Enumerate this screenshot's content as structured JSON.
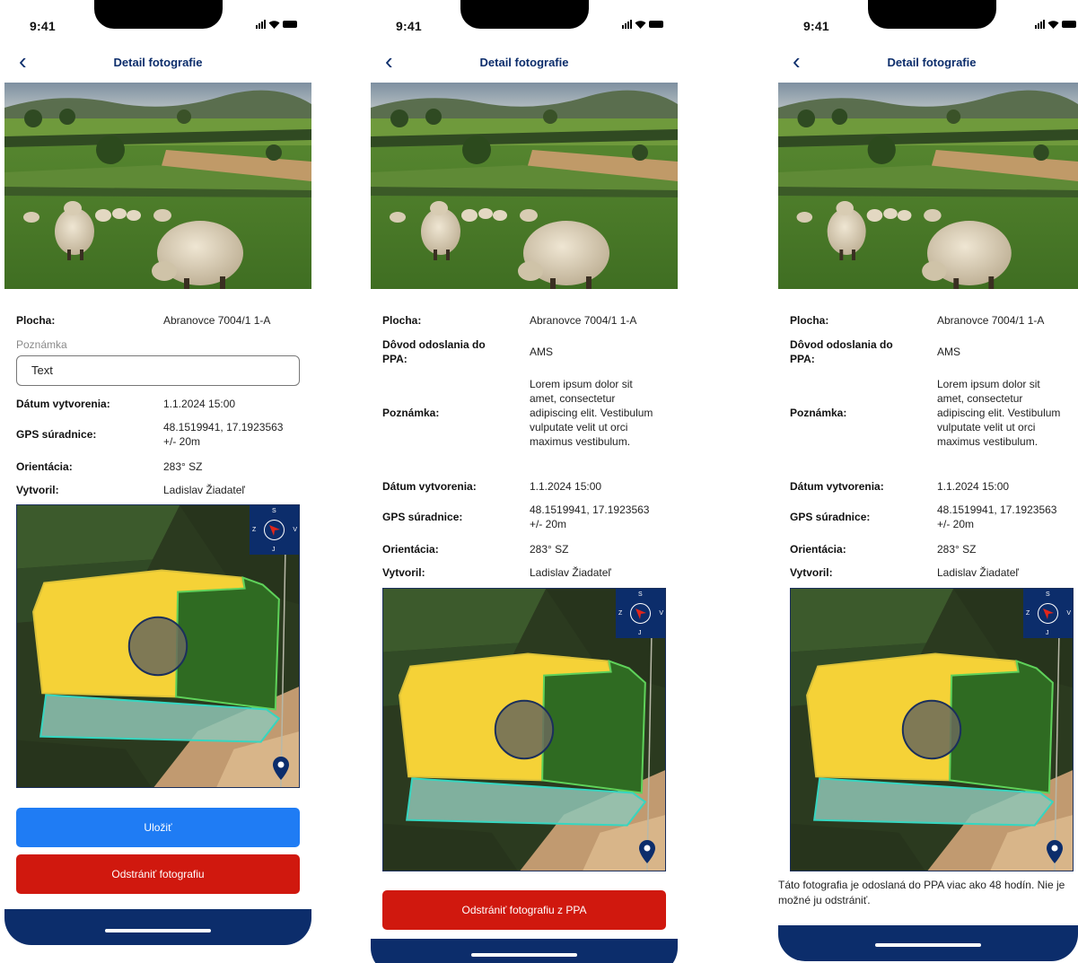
{
  "status": {
    "time": "9:41"
  },
  "screens": [
    {
      "title": "Detail fotografie",
      "fields": {
        "plocha_label": "Plocha:",
        "plocha_value": "Abranovce 7004/1 1-A",
        "poznamka_label": "Poznámka",
        "poznamka_value": "Text",
        "datum_label": "Dátum vytvorenia:",
        "datum_value": "1.1.2024 15:00",
        "gps_label": "GPS súradnice:",
        "gps_value": "48.1519941, 17.1923563 +/- 20m",
        "orientacia_label": "Orientácia:",
        "orientacia_value": "283° SZ",
        "vytvoril_label": "Vytvoril:",
        "vytvoril_value": "Ladislav Žiadateľ"
      },
      "compass": {
        "n": "S",
        "e": "V",
        "s": "J",
        "w": "Z"
      },
      "buttons": {
        "save": "Uložiť",
        "delete": "Odstrániť fotografiu"
      }
    },
    {
      "title": "Detail fotografie",
      "fields": {
        "plocha_label": "Plocha:",
        "plocha_value": "Abranovce 7004/1 1-A",
        "dovod_label": "Dôvod odoslania do PPA:",
        "dovod_value": "AMS",
        "poznamka_label": "Poznámka:",
        "poznamka_value": "Lorem ipsum dolor sit amet, consectetur adipiscing elit. Vestibulum vulputate velit ut orci maximus vestibulum.",
        "datum_label": "Dátum vytvorenia:",
        "datum_value": "1.1.2024 15:00",
        "gps_label": "GPS súradnice:",
        "gps_value": "48.1519941, 17.1923563 +/- 20m",
        "orientacia_label": "Orientácia:",
        "orientacia_value": "283° SZ",
        "vytvoril_label": "Vytvoril:",
        "vytvoril_value": "Ladislav Žiadateľ"
      },
      "compass": {
        "n": "S",
        "e": "V",
        "s": "J",
        "w": "Z"
      },
      "buttons": {
        "delete": "Odstrániť fotografiu z PPA"
      }
    },
    {
      "title": "Detail fotografie",
      "fields": {
        "plocha_label": "Plocha:",
        "plocha_value": "Abranovce 7004/1 1-A",
        "dovod_label": "Dôvod odoslania do PPA:",
        "dovod_value": "AMS",
        "poznamka_label": "Poznámka:",
        "poznamka_value": "Lorem ipsum dolor sit amet, consectetur adipiscing elit. Vestibulum vulputate velit ut orci maximus vestibulum.",
        "datum_label": "Dátum vytvorenia:",
        "datum_value": "1.1.2024 15:00",
        "gps_label": "GPS súradnice:",
        "gps_value": "48.1519941, 17.1923563 +/- 20m",
        "orientacia_label": "Orientácia:",
        "orientacia_value": "283° SZ",
        "vytvoril_label": "Vytvoril:",
        "vytvoril_value": "Ladislav Žiadateľ"
      },
      "compass": {
        "n": "S",
        "e": "V",
        "s": "J",
        "w": "Z"
      },
      "info": "Táto fotografia je odoslaná do PPA viac ako 48 hodín. Nie je možné ju odstrániť."
    }
  ],
  "colors": {
    "brand_navy": "#0c2d6b",
    "save_blue": "#1f7cf4",
    "delete_red": "#d0180e"
  },
  "icons": [
    "back-chevron-icon",
    "signal-icon",
    "wifi-icon",
    "battery-icon",
    "location-pin-icon",
    "compass-arrow-icon"
  ]
}
